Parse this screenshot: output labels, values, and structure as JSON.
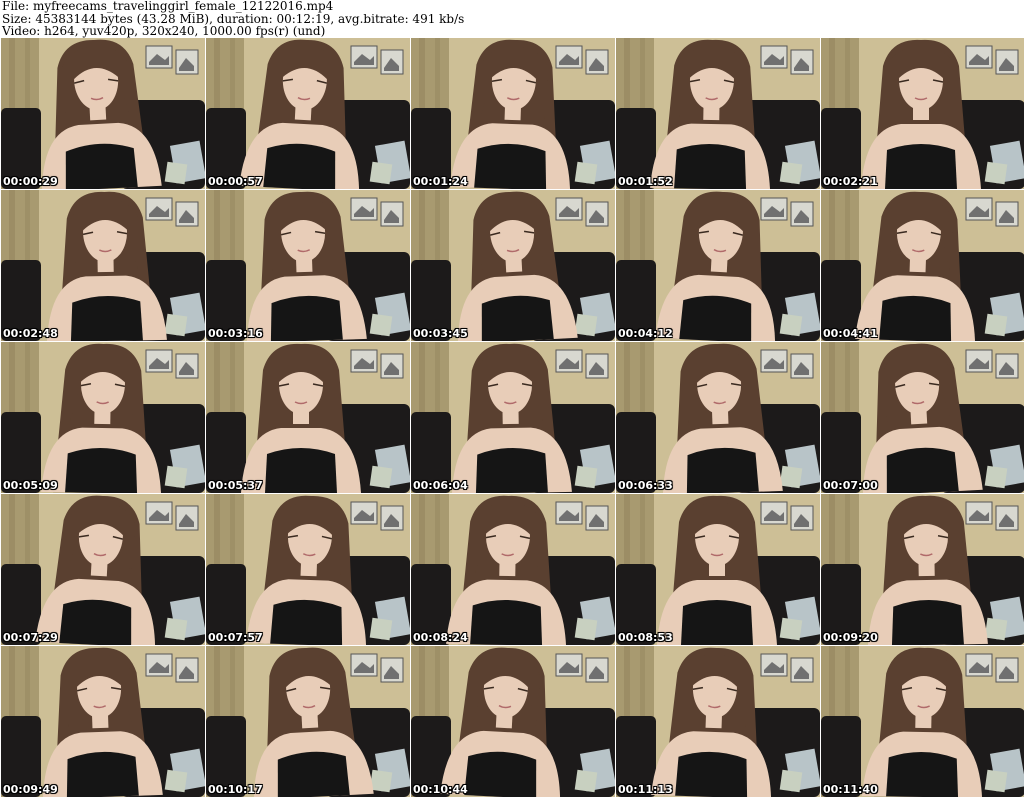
{
  "header": {
    "file_line": "File: myfreecams_travelinggirl_female_12122016.mp4",
    "size_line": "Size: 45383144 bytes (43.28 MiB), duration: 00:12:19, avg.bitrate: 491 kb/s",
    "video_line": "Video: h264, yuv420p, 320x240, 1000.00 fps(r) (und)"
  },
  "thumbnails": [
    {
      "timestamp": "00:00:29"
    },
    {
      "timestamp": "00:00:57"
    },
    {
      "timestamp": "00:01:24"
    },
    {
      "timestamp": "00:01:52"
    },
    {
      "timestamp": "00:02:21"
    },
    {
      "timestamp": "00:02:48"
    },
    {
      "timestamp": "00:03:16"
    },
    {
      "timestamp": "00:03:45"
    },
    {
      "timestamp": "00:04:12"
    },
    {
      "timestamp": "00:04:41"
    },
    {
      "timestamp": "00:05:09"
    },
    {
      "timestamp": "00:05:37"
    },
    {
      "timestamp": "00:06:04"
    },
    {
      "timestamp": "00:06:33"
    },
    {
      "timestamp": "00:07:00"
    },
    {
      "timestamp": "00:07:29"
    },
    {
      "timestamp": "00:07:57"
    },
    {
      "timestamp": "00:08:24"
    },
    {
      "timestamp": "00:08:53"
    },
    {
      "timestamp": "00:09:20"
    },
    {
      "timestamp": "00:09:49"
    },
    {
      "timestamp": "00:10:17"
    },
    {
      "timestamp": "00:10:44"
    },
    {
      "timestamp": "00:11:13"
    },
    {
      "timestamp": "00:11:40"
    }
  ],
  "colors": {
    "wall": "#cdbf96",
    "curtain": "#a89a70",
    "sofa": "#1c1a1a",
    "hair": "#5a4030",
    "skin": "#e8cdb8",
    "top": "#151515",
    "frame": "#d8d8d0",
    "pillow": "#b8c4c8"
  }
}
